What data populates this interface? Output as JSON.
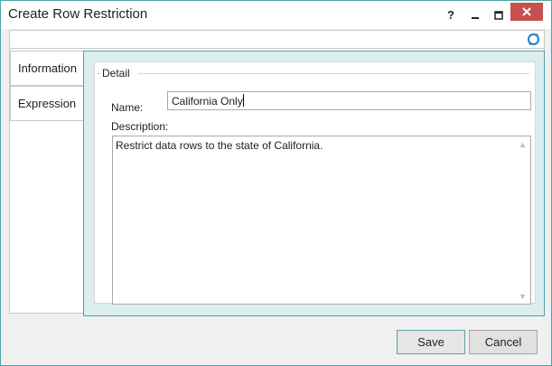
{
  "window": {
    "title": "Create Row Restriction",
    "help_label": "?",
    "minimize_label": "‒",
    "maximize_label": "☐",
    "close_label": "✕"
  },
  "toolbar": {
    "refresh_icon": "refresh-icon"
  },
  "tabs": [
    {
      "label": "Information",
      "selected": true
    },
    {
      "label": "Expression",
      "selected": false
    }
  ],
  "detail": {
    "group_label": "Detail",
    "name_label": "Name:",
    "name_value": "California Only",
    "description_label": "Description:",
    "description_value": "Restrict data rows to the state of California."
  },
  "buttons": {
    "save_label": "Save",
    "cancel_label": "Cancel"
  },
  "colors": {
    "accent": "#4fa6a6",
    "pane_bg": "#dbeff0",
    "close_bg": "#c75050"
  }
}
